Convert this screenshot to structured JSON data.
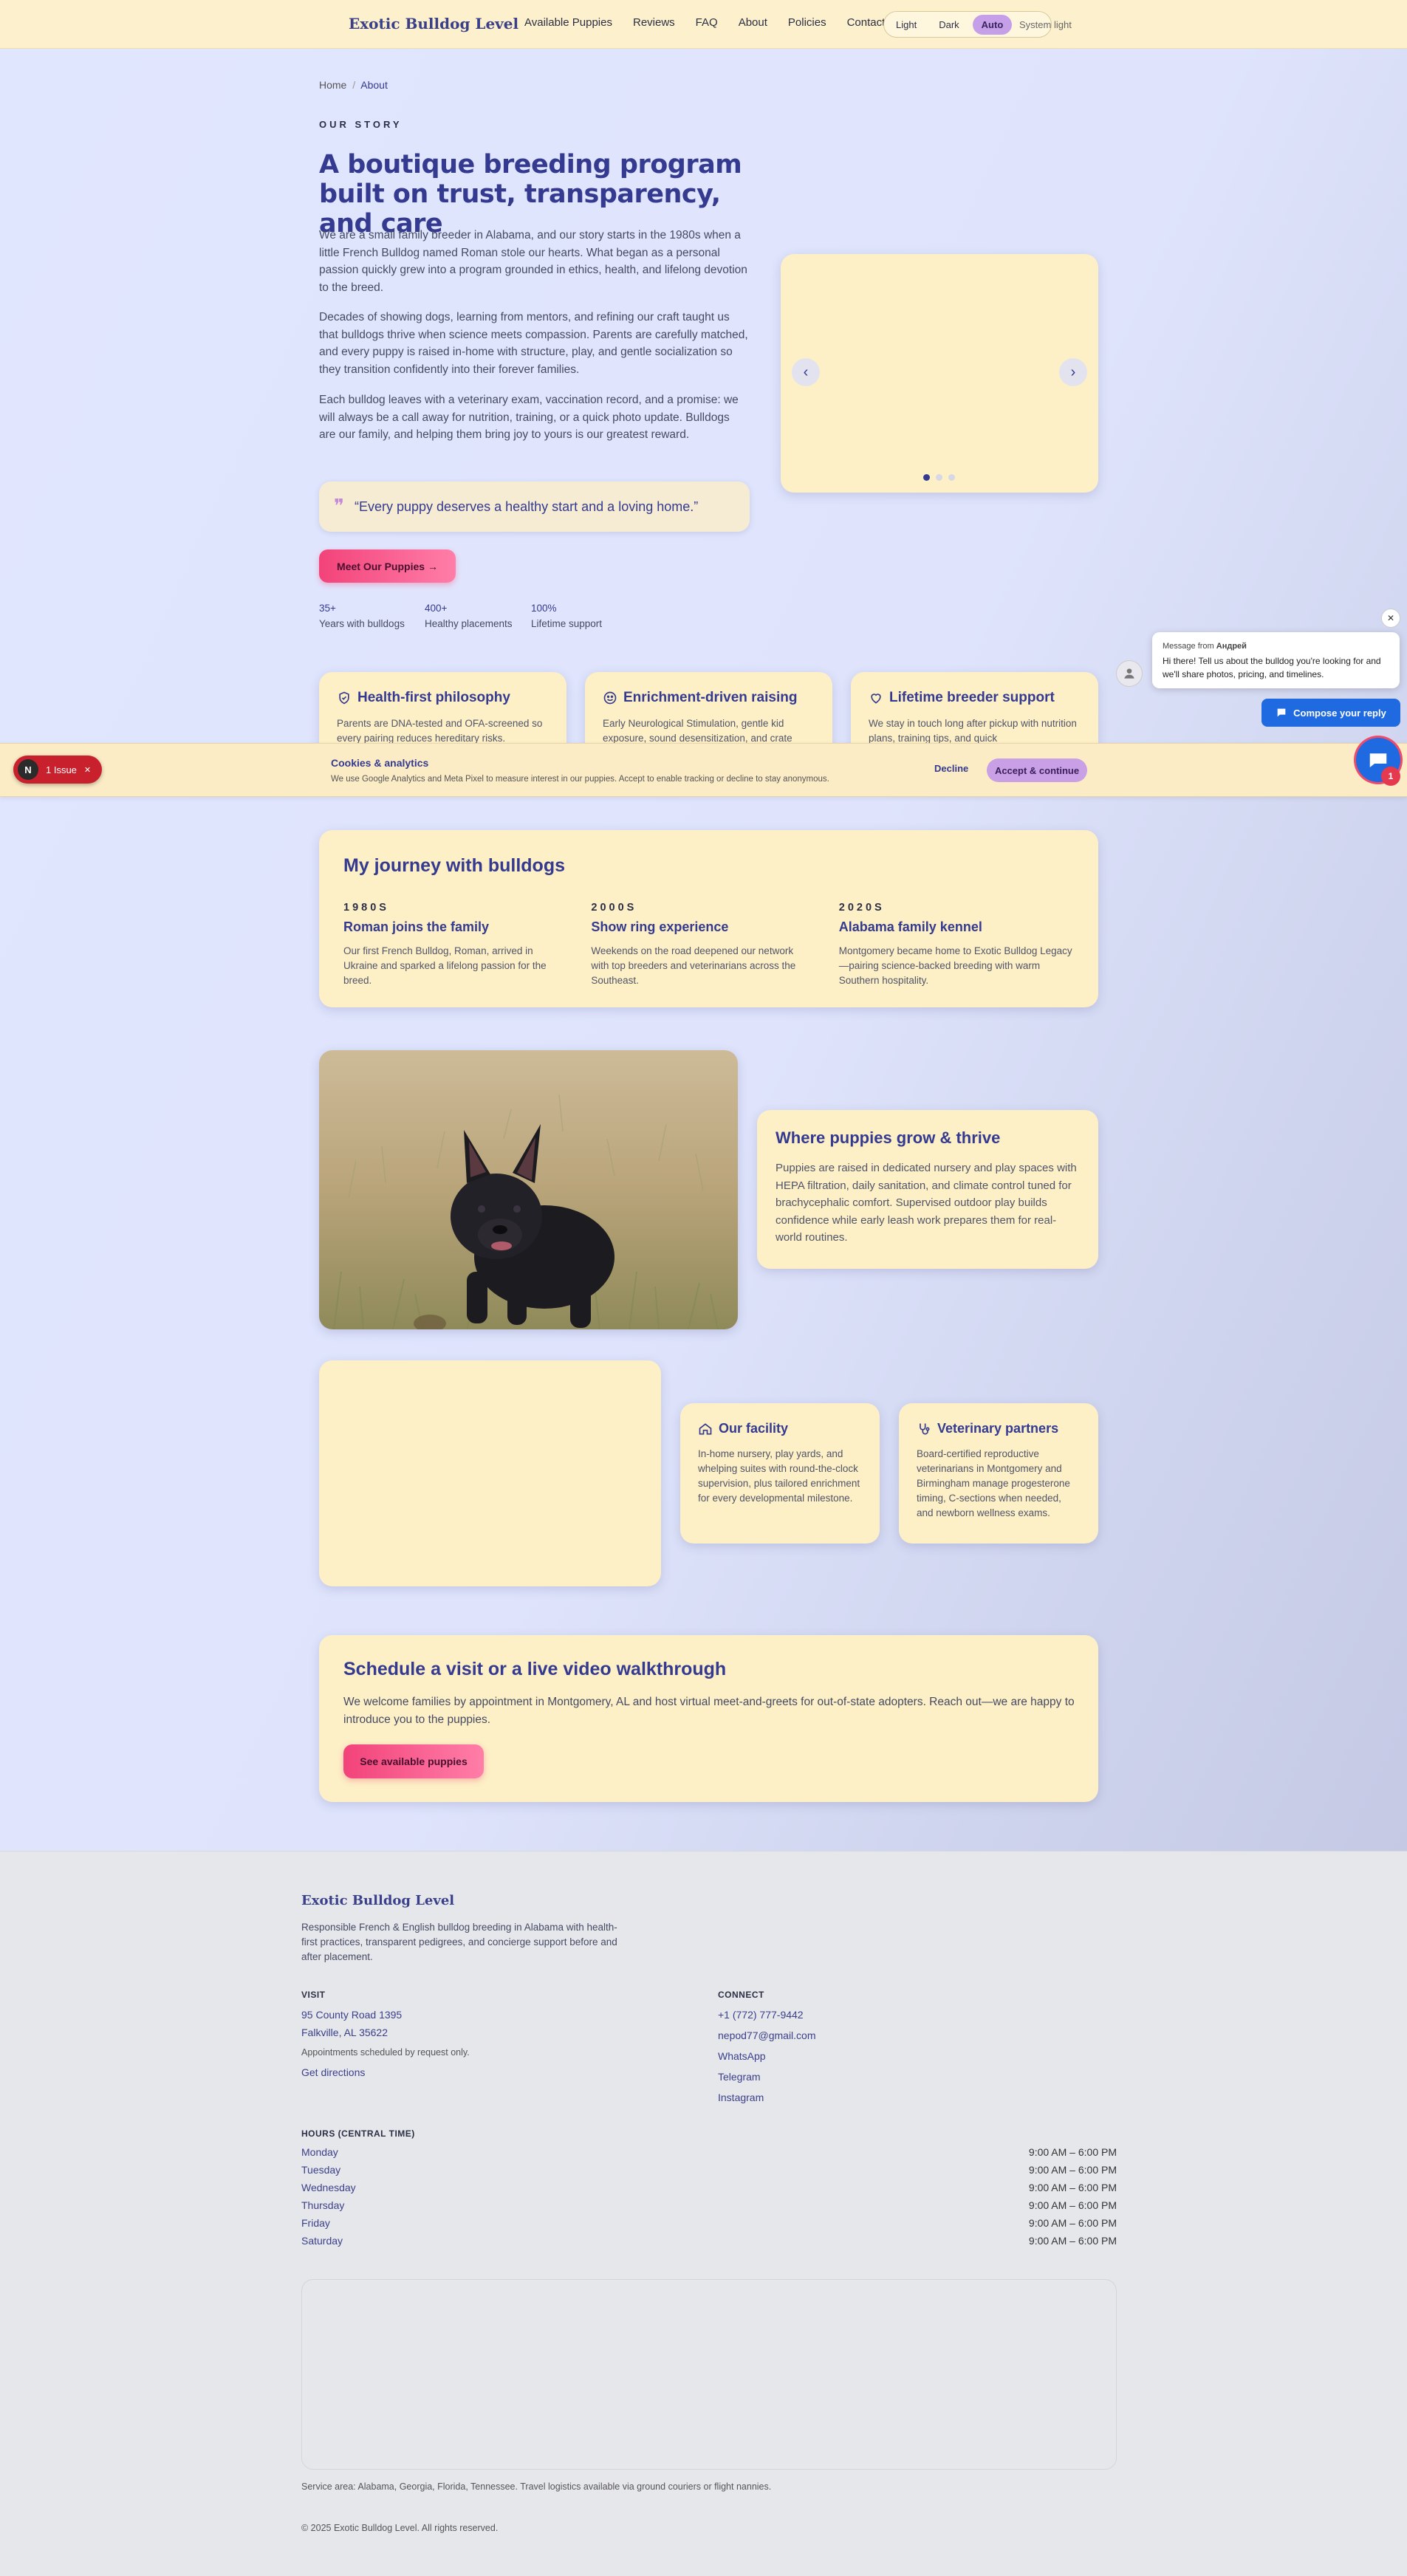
{
  "brand": {
    "name": "Exotic Bulldog Level"
  },
  "nav": {
    "items": [
      "Available Puppies",
      "Reviews",
      "FAQ",
      "About",
      "Policies",
      "Contact"
    ]
  },
  "theme": {
    "options": [
      "Light",
      "Dark",
      "Auto"
    ],
    "selected": "Auto",
    "status": "System light"
  },
  "breadcrumb": {
    "home": "Home",
    "separator": "/",
    "current": "About"
  },
  "hero": {
    "eyebrow": "OUR STORY",
    "title": "A boutique breeding program built on trust, transparency, and care",
    "paragraphs": [
      "We are a small family breeder in Alabama, and our story starts in the 1980s when a little French Bulldog named Roman stole our hearts. What began as a personal passion quickly grew into a program grounded in ethics, health, and lifelong devotion to the breed.",
      "Decades of showing dogs, learning from mentors, and refining our craft taught us that bulldogs thrive when science meets compassion. Parents are carefully matched, and every puppy is raised in-home with structure, play, and gentle socialization so they transition confidently into their forever families.",
      "Each bulldog leaves with a veterinary exam, vaccination record, and a promise: we will always be a call away for nutrition, training, or a quick photo update. Bulldogs are our family, and helping them bring joy to yours is our greatest reward."
    ],
    "quote": "“Every puppy deserves a healthy start and a loving home.”",
    "cta": "Meet Our Puppies →",
    "stats": [
      {
        "value": "35+",
        "label": "Years with bulldogs"
      },
      {
        "value": "400+",
        "label": "Healthy placements"
      },
      {
        "value": "100%",
        "label": "Lifetime support"
      }
    ]
  },
  "carousel": {
    "prev": "‹",
    "next": "›",
    "slides": 3,
    "active": 0
  },
  "features": [
    {
      "icon": "shield-check-icon",
      "title": "Health-first philosophy",
      "body": "Parents are DNA-tested and OFA-screened so every pairing reduces hereditary risks."
    },
    {
      "icon": "smile-icon",
      "title": "Enrichment-driven raising",
      "body": "Early Neurological Stimulation, gentle kid exposure, sound desensitization, and crate"
    },
    {
      "icon": "heart-icon",
      "title": "Lifetime breeder support",
      "body": "We stay in touch long after pickup with nutrition plans, training tips, and quick"
    }
  ],
  "cookie": {
    "title": "Cookies & analytics",
    "text": "We use Google Analytics and Meta Pixel to measure interest in our puppies. Accept to enable tracking or decline to stay anonymous.",
    "decline": "Decline",
    "accept": "Accept & continue"
  },
  "devtools": {
    "badge": "N",
    "label": "1 Issue",
    "close": "✕"
  },
  "journey": {
    "title": "My journey with bulldogs",
    "items": [
      {
        "era": "1980S",
        "title": "Roman joins the family",
        "body": "Our first French Bulldog, Roman, arrived in Ukraine and sparked a lifelong passion for the breed."
      },
      {
        "era": "2000S",
        "title": "Show ring experience",
        "body": "Weekends on the road deepened our network with top breeders and veterinarians across the Southeast."
      },
      {
        "era": "2020S",
        "title": "Alabama family kennel",
        "body": "Montgomery became home to Exotic Bulldog Legacy—pairing science-backed breeding with warm Southern hospitality."
      }
    ]
  },
  "grow": {
    "title": "Where puppies grow & thrive",
    "body": "Puppies are raised in dedicated nursery and play spaces with HEPA filtration, daily sanitation, and climate control tuned for brachycephalic comfort. Supervised outdoor play builds confidence while early leash work prepares them for real-world routines."
  },
  "facility": {
    "title": "Our facility",
    "icon": "home-icon",
    "body": "In-home nursery, play yards, and whelping suites with round-the-clock supervision, plus tailored enrichment for every developmental milestone."
  },
  "vets": {
    "title": "Veterinary partners",
    "icon": "stethoscope-icon",
    "body": "Board-certified reproductive veterinarians in Montgomery and Birmingham manage progesterone timing, C-sections when needed, and newborn wellness exams."
  },
  "visit": {
    "title": "Schedule a visit or a live video walkthrough",
    "body": "We welcome families by appointment in Montgomery, AL and host virtual meet-and-greets for out-of-state adopters. Reach out—we are happy to introduce you to the puppies.",
    "cta": "See available puppies"
  },
  "chat": {
    "from_prefix": "Message from",
    "from_name": "Андрей",
    "message": "Hi there! Tell us about the bulldog you're looking for and we'll share photos, pricing, and timelines.",
    "close": "✕",
    "compose": "Compose your reply",
    "unread": "1"
  },
  "footer": {
    "brand": "Exotic Bulldog Level",
    "tagline": "Responsible French & English bulldog breeding in Alabama with health-first practices, transparent pedigrees, and concierge support before and after placement.",
    "visit_head": "VISIT",
    "address1": "95 County Road 1395",
    "address2": "Falkville, AL 35622",
    "appt": "Appointments scheduled by request only.",
    "directions": "Get directions",
    "connect_head": "CONNECT",
    "phone": "+1 (772) 777-9442",
    "email": "nepod77@gmail.com",
    "whatsapp": "WhatsApp",
    "telegram": "Telegram",
    "instagram": "Instagram",
    "hours_head": "HOURS (CENTRAL TIME)",
    "hours": [
      {
        "day": "Monday",
        "time": "9:00 AM – 6:00 PM"
      },
      {
        "day": "Tuesday",
        "time": "9:00 AM – 6:00 PM"
      },
      {
        "day": "Wednesday",
        "time": "9:00 AM – 6:00 PM"
      },
      {
        "day": "Thursday",
        "time": "9:00 AM – 6:00 PM"
      },
      {
        "day": "Friday",
        "time": "9:00 AM – 6:00 PM"
      },
      {
        "day": "Saturday",
        "time": "9:00 AM – 6:00 PM"
      }
    ],
    "service_area": "Service area: Alabama, Georgia, Florida, Tennessee. Travel logistics available via ground couriers or flight nannies.",
    "copyright": "© 2025 Exotic Bulldog Level. All rights reserved."
  },
  "colors": {
    "accent": "#343a8f",
    "card": "#fdefc6",
    "pink": "#f2437a",
    "chat_blue": "#1f6ae0"
  }
}
